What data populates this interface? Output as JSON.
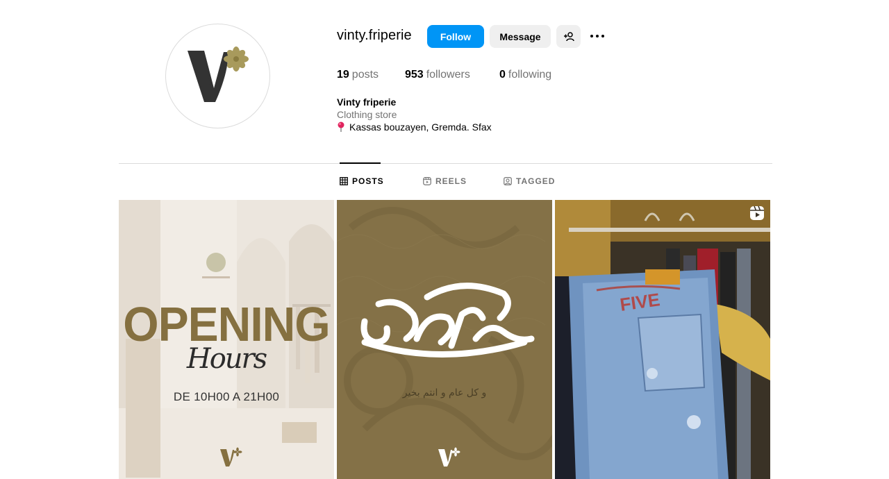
{
  "profile": {
    "username": "vinty.friperie",
    "follow_label": "Follow",
    "message_label": "Message",
    "stats": {
      "posts_count": "19",
      "posts_label": "posts",
      "followers_count": "953",
      "followers_label": "followers",
      "following_count": "0",
      "following_label": "following"
    },
    "bio": {
      "name": "Vinty friperie",
      "category": "Clothing store",
      "location": "Kassas bouzayen, Gremda. Sfax"
    }
  },
  "tabs": [
    {
      "label": "POSTS",
      "icon": "grid-icon",
      "active": true
    },
    {
      "label": "REELS",
      "icon": "reels-icon",
      "active": false
    },
    {
      "label": "TAGGED",
      "icon": "tagged-icon",
      "active": false
    }
  ],
  "posts": [
    {
      "title": "OPENING",
      "subtitle": "Hours",
      "detail": "DE 10H00 A 21H00"
    },
    {
      "title": "عيدكم مبارك",
      "detail": "و كل عام و انتم بخير"
    },
    {
      "content": "jeans-on-rack-photo",
      "badge": "reel-icon"
    }
  ],
  "colors": {
    "accent_blue": "#0095f6",
    "brand_gold": "#857040",
    "muted_text": "#737373"
  }
}
